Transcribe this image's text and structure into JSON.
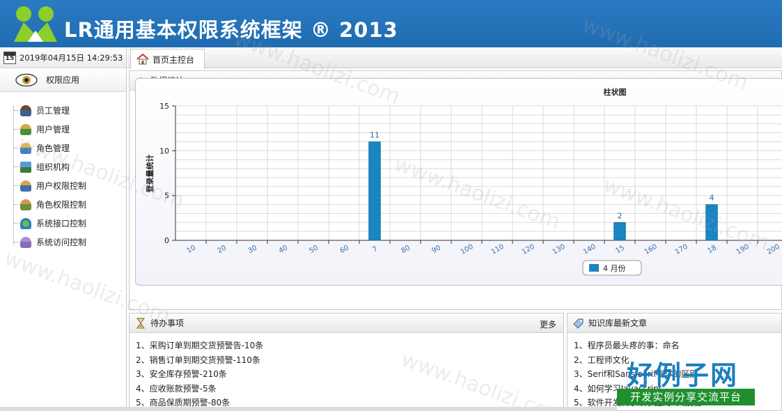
{
  "header": {
    "title": "LR通用基本权限系统框架 ® 2013"
  },
  "left": {
    "datetime": "2019年04月15日 14:29:53",
    "section_title": "权限应用",
    "items": [
      {
        "label": "员工管理"
      },
      {
        "label": "用户管理"
      },
      {
        "label": "角色管理"
      },
      {
        "label": "组织机构"
      },
      {
        "label": "用户权限控制"
      },
      {
        "label": "角色权限控制"
      },
      {
        "label": "系统接口控制"
      },
      {
        "label": "系统访问控制"
      }
    ]
  },
  "tabs": {
    "home": "首页主控台"
  },
  "stats_panel": {
    "title": "数据统计"
  },
  "chart_data": {
    "type": "bar",
    "title": "柱状图",
    "ylabel": "登录量统计",
    "xlabel": "",
    "ylim": [
      0,
      15
    ],
    "yticks": [
      0,
      5,
      10,
      15
    ],
    "categories": [
      "10",
      "20",
      "30",
      "40",
      "50",
      "60",
      "7",
      "80",
      "90",
      "100",
      "110",
      "120",
      "130",
      "140",
      "15",
      "160",
      "170",
      "18",
      "190",
      "200"
    ],
    "series": [
      {
        "name": "4 月份",
        "values": [
          0,
          0,
          0,
          0,
          0,
          0,
          11,
          0,
          0,
          0,
          0,
          0,
          0,
          0,
          2,
          0,
          0,
          4,
          0,
          0
        ]
      }
    ],
    "grid": true,
    "legend": "bottom-center"
  },
  "todo_panel": {
    "title": "待办事项",
    "more": "更多",
    "items": [
      "1、采购订单到期交货预警告-10条",
      "2、销售订单到期交货预警-110条",
      "3、安全库存预警-210条",
      "4、应收账款预警-5条",
      "5、商品保质期预警-80条"
    ]
  },
  "kb_panel": {
    "title": "知识库最新文章",
    "items": [
      "1、程序员最头疼的事：命名",
      "2、工程师文化",
      "3、Serif和Sans-serif字体的区别",
      "4、如何学习Javascript",
      "5、软件开发高手须掌握的4大技能"
    ]
  },
  "watermark": {
    "text": "www.haolizi.com",
    "badge_top": "好例子网",
    "badge_bottom": "开发实例分享交流平台"
  },
  "colors": {
    "header": "#1f6bb0",
    "bar": "#1a85c2",
    "badge_green": "#1f8f2f"
  }
}
